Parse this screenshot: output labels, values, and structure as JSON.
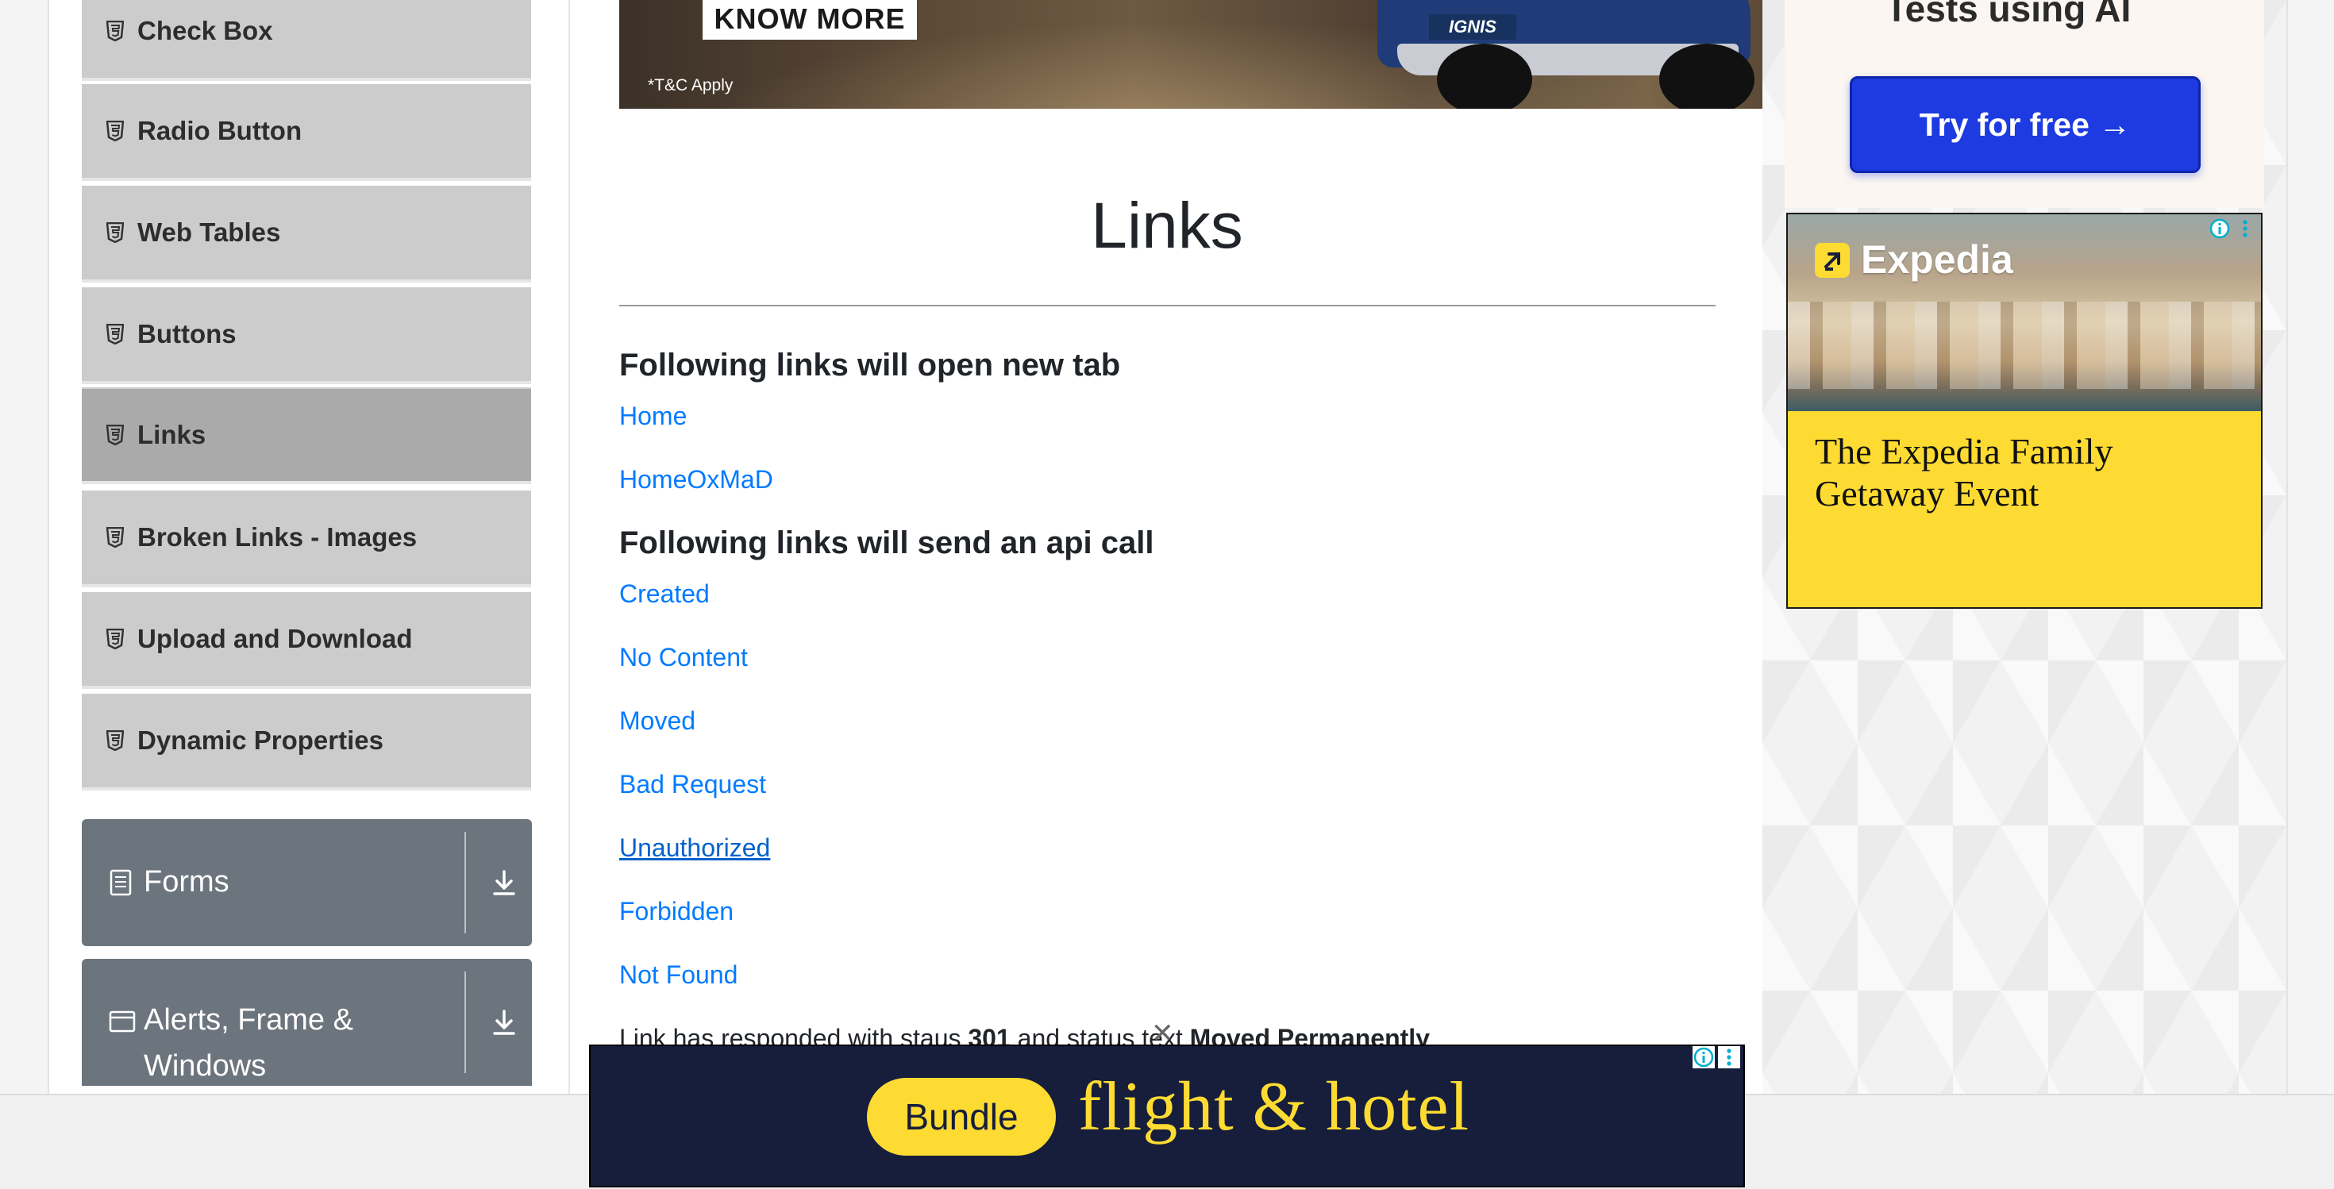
{
  "sidebar": {
    "items": [
      {
        "label": "Check Box",
        "active": false
      },
      {
        "label": "Radio Button",
        "active": false
      },
      {
        "label": "Web Tables",
        "active": false
      },
      {
        "label": "Buttons",
        "active": false
      },
      {
        "label": "Links",
        "active": true
      },
      {
        "label": "Broken Links - Images",
        "active": false
      },
      {
        "label": "Upload and Download",
        "active": false
      },
      {
        "label": "Dynamic Properties",
        "active": false
      }
    ],
    "groups": [
      {
        "title": "Forms",
        "icon": "form-icon"
      },
      {
        "title_line1": "Alerts, Frame &",
        "title_line2": "Windows",
        "icon": "window-icon"
      }
    ]
  },
  "top_banner": {
    "cta": "KNOW MORE",
    "disclaimer": "*T&C Apply",
    "car_badge": "IGNIS"
  },
  "main": {
    "title": "Links",
    "section_new_tab": "Following links will open new tab",
    "new_tab_links": [
      "Home",
      "HomeOxMaD"
    ],
    "section_api": "Following links will send an api call",
    "api_links": [
      "Created",
      "No Content",
      "Moved",
      "Bad Request",
      "Unauthorized",
      "Forbidden",
      "Not Found"
    ],
    "response": {
      "prefix": "Link has responded with staus",
      "status_code": "301",
      "middle": "and status text",
      "status_text": "Moved Permanently"
    }
  },
  "right_ads": {
    "ai_text": "Tests using AI",
    "ai_button": "Try for free →",
    "expedia_logo": "Expedia",
    "expedia_headline": "The Expedia Family Getaway Event"
  },
  "bottom_ad": {
    "pill": "Bundle",
    "text": "flight & hotel"
  },
  "colors": {
    "link": "#007bff",
    "sidebar_item": "#cccccc",
    "sidebar_active": "#aaaaaa",
    "group_card": "#6c757d",
    "ad_yellow": "#fddb32",
    "ad_navy": "#161e3b",
    "ai_button": "#1d3be0"
  }
}
